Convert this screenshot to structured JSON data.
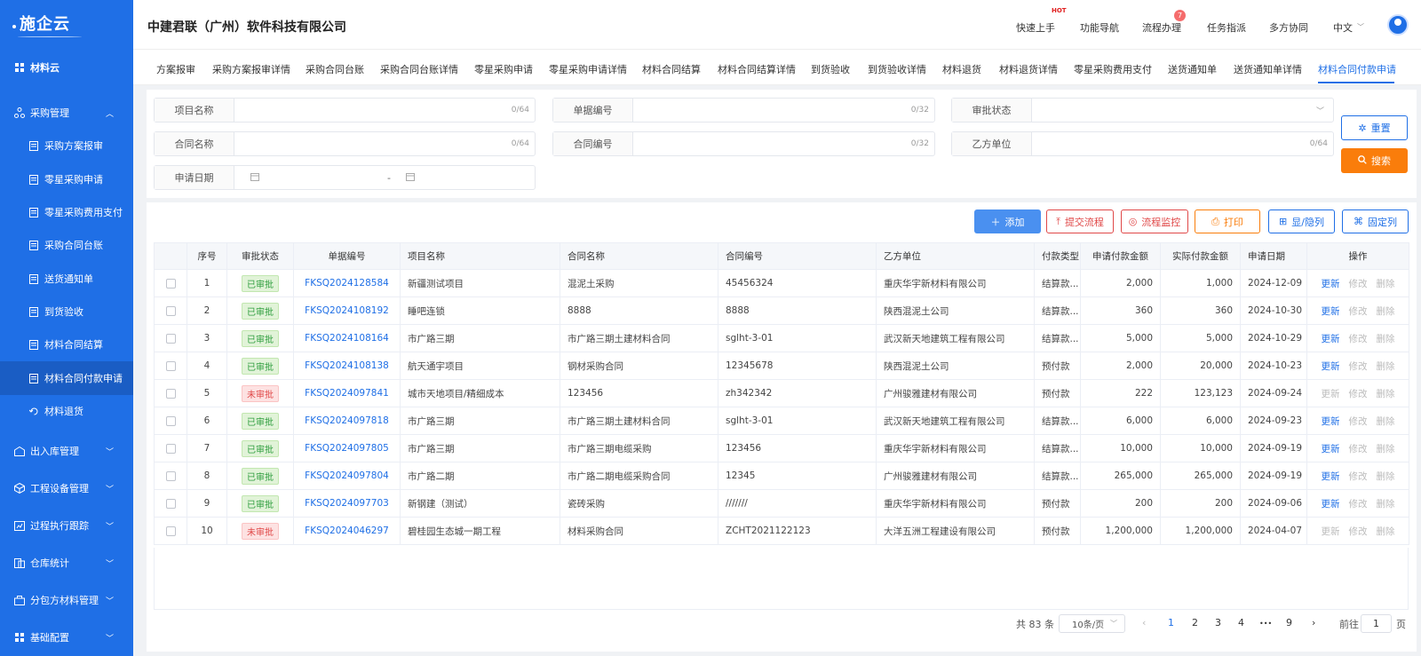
{
  "sidebar": {
    "logo": "施企云",
    "app": "材料云",
    "groups": {
      "purchase": "采购管理",
      "inout": "出入库管理",
      "equipment": "工程设备管理",
      "process": "过程执行跟踪",
      "warehouse": "仓库统计",
      "subcontract": "分包方材料管理",
      "base": "基础配置"
    },
    "sub": [
      "采购方案报审",
      "零星采购申请",
      "零星采购费用支付",
      "采购合同台账",
      "送货通知单",
      "到货验收",
      "材料合同结算",
      "材料合同付款申请",
      "材料退货"
    ]
  },
  "header": {
    "company": "中建君联（广州）软件科技有限公司",
    "nav": [
      "快速上手",
      "功能导航",
      "流程办理",
      "任务指派",
      "多方协同",
      "中文"
    ],
    "hot": "HOT",
    "badge": "7"
  },
  "tabs": [
    "方案报审",
    "采购方案报审详情",
    "采购合同台账",
    "采购合同台账详情",
    "零星采购申请",
    "零星采购申请详情",
    "材料合同结算",
    "材料合同结算详情",
    "到货验收",
    "到货验收详情",
    "材料退货",
    "材料退货详情",
    "零星采购费用支付",
    "送货通知单",
    "送货通知单详情",
    "材料合同付款申请"
  ],
  "filter": {
    "project_name": "项目名称",
    "doc_no": "单据编号",
    "approval_status": "审批状态",
    "contract_name": "合同名称",
    "contract_no": "合同编号",
    "party_b": "乙方单位",
    "apply_date": "申请日期",
    "count64": "0/64",
    "count32": "0/32",
    "date_sep": "-",
    "reset": "重置",
    "search": "搜索"
  },
  "toolbar": {
    "add": "添加",
    "submit": "提交流程",
    "monitor": "流程监控",
    "print": "打印",
    "toggle": "显/隐列",
    "fixed": "固定列"
  },
  "table": {
    "headers": [
      "序号",
      "审批状态",
      "单据编号",
      "项目名称",
      "合同名称",
      "合同编号",
      "乙方单位",
      "付款类型",
      "申请付款金额",
      "实际付款金额",
      "申请日期",
      "操作"
    ],
    "ops": [
      "更新",
      "修改",
      "删除"
    ],
    "rows": [
      {
        "no": "1",
        "status": "已审批",
        "doc": "FKSQ2024128584",
        "project": "新疆测试项目",
        "contract": "混泥土采购",
        "cno": "45456324",
        "partyb": "重庆华宇新材料有限公司",
        "type": "结算款...",
        "apply": "2,000",
        "actual": "1,000",
        "date": "2024-12-09"
      },
      {
        "no": "2",
        "status": "已审批",
        "doc": "FKSQ2024108192",
        "project": "睡吧连锁",
        "contract": "8888",
        "cno": "8888",
        "partyb": "陕西混泥土公司",
        "type": "结算款...",
        "apply": "360",
        "actual": "360",
        "date": "2024-10-30"
      },
      {
        "no": "3",
        "status": "已审批",
        "doc": "FKSQ2024108164",
        "project": "市广路三期",
        "contract": "市广路三期土建材料合同",
        "cno": "sglht-3-01",
        "partyb": "武汉新天地建筑工程有限公司",
        "type": "结算款...",
        "apply": "5,000",
        "actual": "5,000",
        "date": "2024-10-29"
      },
      {
        "no": "4",
        "status": "已审批",
        "doc": "FKSQ2024108138",
        "project": "航天通宇项目",
        "contract": "钢材采购合同",
        "cno": "12345678",
        "partyb": "陕西混泥土公司",
        "type": "预付款",
        "apply": "2,000",
        "actual": "20,000",
        "date": "2024-10-23"
      },
      {
        "no": "5",
        "status": "未审批",
        "doc": "FKSQ2024097841",
        "project": "城市天地项目/精细成本",
        "contract": "123456",
        "cno": "zh342342",
        "partyb": "广州骏雅建材有限公司",
        "type": "预付款",
        "apply": "222",
        "actual": "123,123",
        "date": "2024-09-24"
      },
      {
        "no": "6",
        "status": "已审批",
        "doc": "FKSQ2024097818",
        "project": "市广路三期",
        "contract": "市广路三期土建材料合同",
        "cno": "sglht-3-01",
        "partyb": "武汉新天地建筑工程有限公司",
        "type": "结算款...",
        "apply": "6,000",
        "actual": "6,000",
        "date": "2024-09-23"
      },
      {
        "no": "7",
        "status": "已审批",
        "doc": "FKSQ2024097805",
        "project": "市广路三期",
        "contract": "市广路三期电缆采购",
        "cno": "123456",
        "partyb": "重庆华宇新材料有限公司",
        "type": "结算款...",
        "apply": "10,000",
        "actual": "10,000",
        "date": "2024-09-19"
      },
      {
        "no": "8",
        "status": "已审批",
        "doc": "FKSQ2024097804",
        "project": "市广路二期",
        "contract": "市广路二期电缆采购合同",
        "cno": "12345",
        "partyb": "广州骏雅建材有限公司",
        "type": "结算款...",
        "apply": "265,000",
        "actual": "265,000",
        "date": "2024-09-19"
      },
      {
        "no": "9",
        "status": "已审批",
        "doc": "FKSQ2024097703",
        "project": "新钢建（测试）",
        "contract": "瓷砖采购",
        "cno": "///////",
        "partyb": "重庆华宇新材料有限公司",
        "type": "预付款",
        "apply": "200",
        "actual": "200",
        "date": "2024-09-06"
      },
      {
        "no": "10",
        "status": "未审批",
        "doc": "FKSQ2024046297",
        "project": "碧桂园生态城一期工程",
        "contract": "材料采购合同",
        "cno": "ZCHT2021122123",
        "partyb": "大洋五洲工程建设有限公司",
        "type": "预付款",
        "apply": "1,200,000",
        "actual": "1,200,000",
        "date": "2024-04-07"
      }
    ]
  },
  "pager": {
    "total": "共 83 条",
    "size": "10条/页",
    "pages": [
      "1",
      "2",
      "3",
      "4",
      "•••",
      "9"
    ],
    "goto": "前往",
    "page_input": "1",
    "page_unit": "页"
  },
  "colors": {
    "primary": "#1f6fe6",
    "sidebar": "#1f6fe6",
    "sidebar_active": "#1a5dc4",
    "orange": "#fa7d0b",
    "danger": "#e04848"
  }
}
